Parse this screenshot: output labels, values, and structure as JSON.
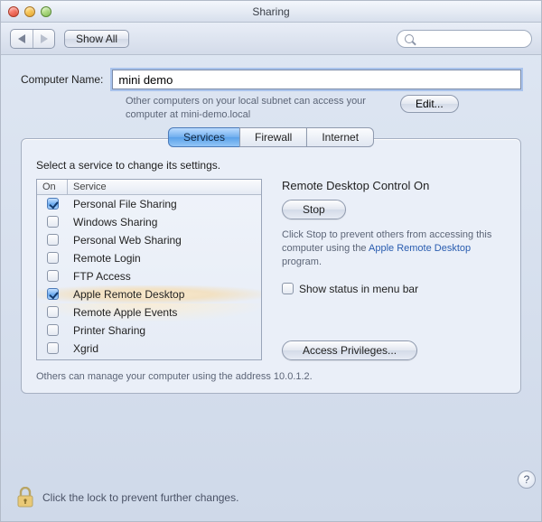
{
  "window": {
    "title": "Sharing"
  },
  "toolbar": {
    "back": "◀",
    "forward": "▶",
    "show_all": "Show All",
    "search_placeholder": ""
  },
  "computer_name": {
    "label": "Computer Name:",
    "value": "mini demo",
    "hint": "Other computers on your local subnet can access your computer at mini-demo.local",
    "edit": "Edit..."
  },
  "tabs": [
    "Services",
    "Firewall",
    "Internet"
  ],
  "instruction": "Select a service to change its settings.",
  "services": {
    "col_on": "On",
    "col_service": "Service",
    "rows": [
      {
        "on": true,
        "name": "Personal File Sharing"
      },
      {
        "on": false,
        "name": "Windows Sharing"
      },
      {
        "on": false,
        "name": "Personal Web Sharing"
      },
      {
        "on": false,
        "name": "Remote Login"
      },
      {
        "on": false,
        "name": "FTP Access"
      },
      {
        "on": true,
        "name": "Apple Remote Desktop"
      },
      {
        "on": false,
        "name": "Remote Apple Events"
      },
      {
        "on": false,
        "name": "Printer Sharing"
      },
      {
        "on": false,
        "name": "Xgrid"
      }
    ]
  },
  "detail": {
    "title": "Remote Desktop Control On",
    "stop": "Stop",
    "desc_pre": "Click Stop to prevent others from accessing this computer using the ",
    "desc_link": "Apple Remote Desktop",
    "desc_post": " program.",
    "show_status": "Show status in menu bar",
    "access_privileges": "Access Privileges..."
  },
  "footer_address": "Others can manage your computer using the address 10.0.1.2.",
  "help": "?",
  "lock": {
    "text": "Click the lock to prevent further changes."
  }
}
